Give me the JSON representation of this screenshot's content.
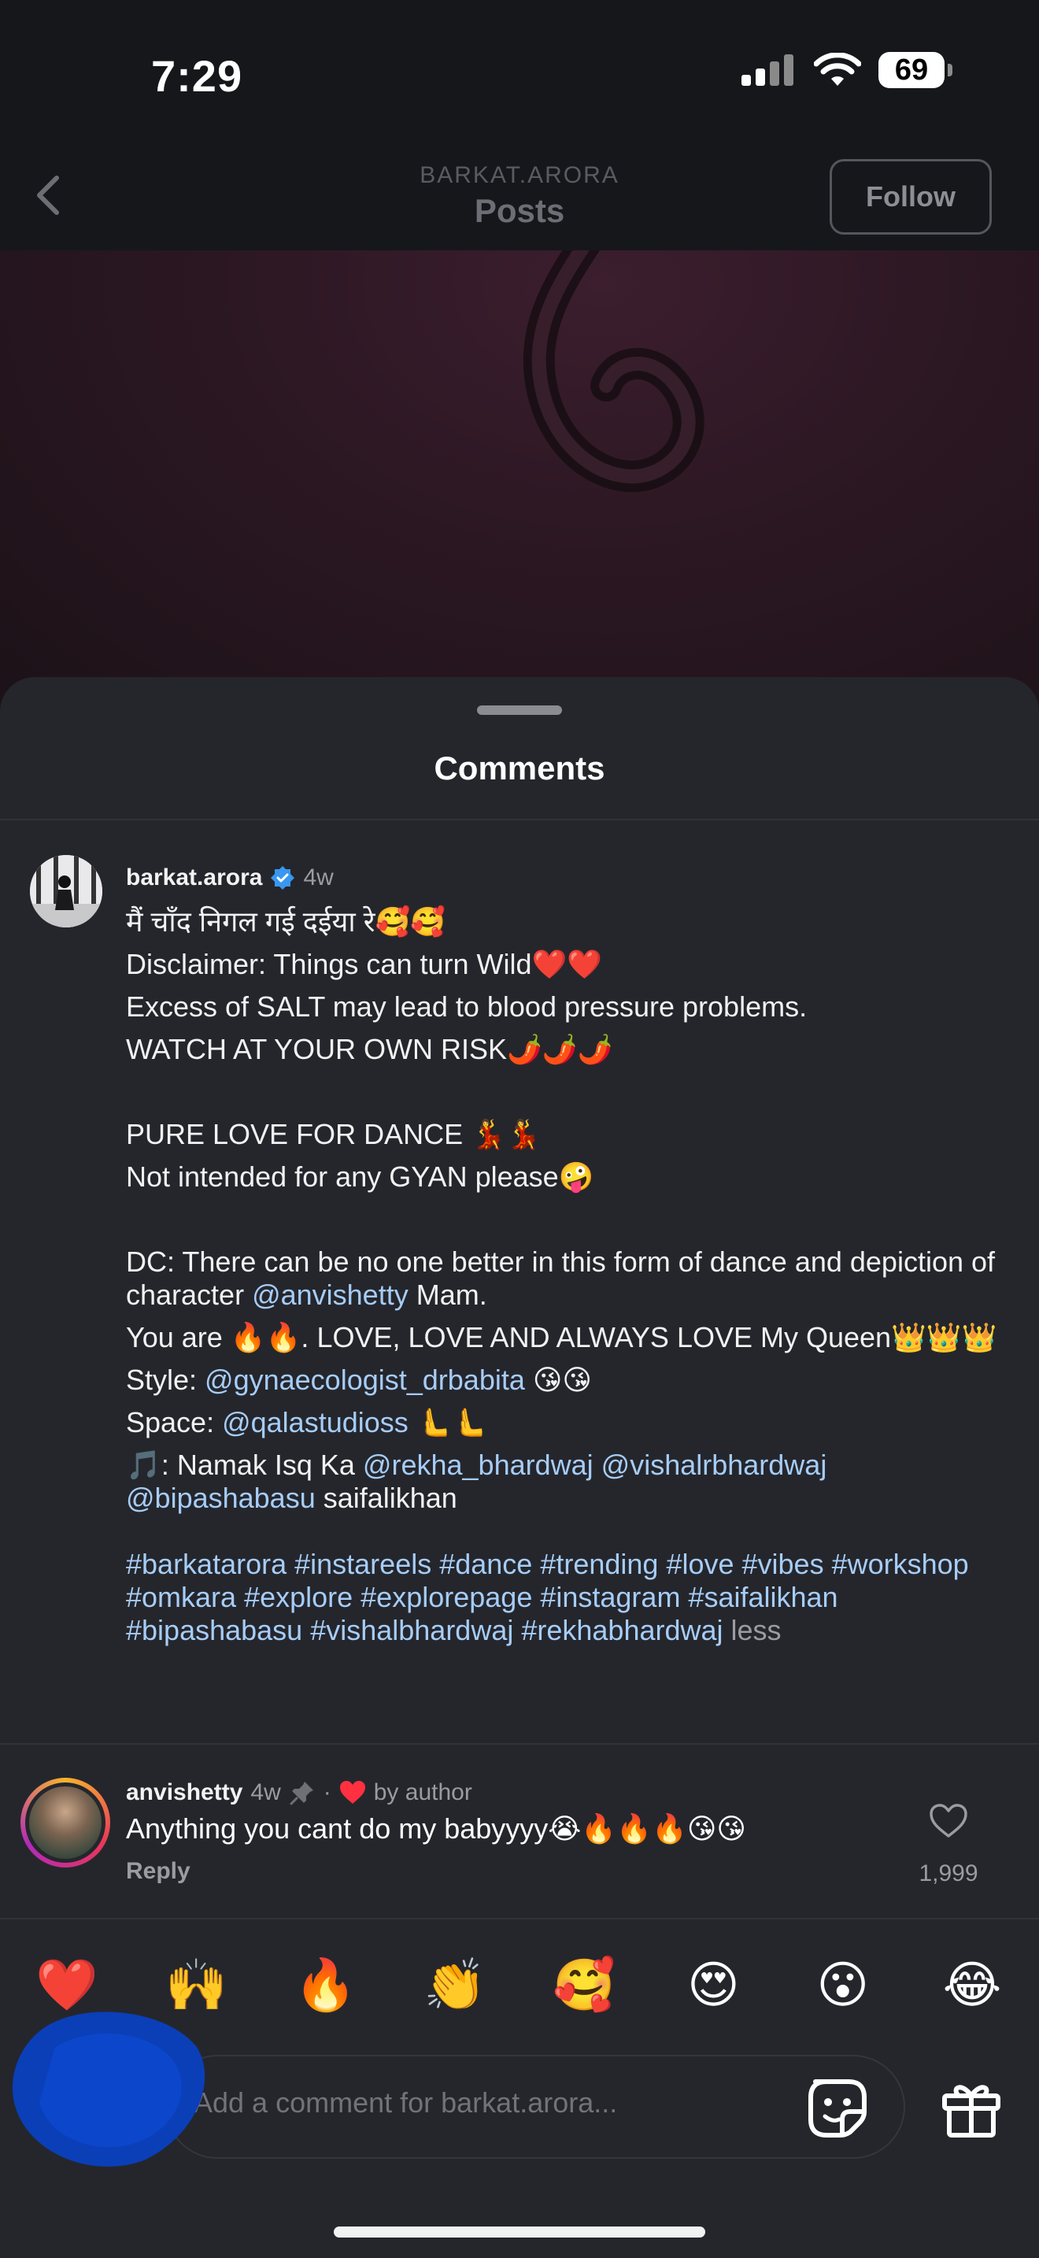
{
  "status_bar": {
    "time": "7:29",
    "battery": "69"
  },
  "header": {
    "subtitle": "BARKAT.ARORA",
    "title": "Posts",
    "follow_label": "Follow"
  },
  "sheet": {
    "title": "Comments"
  },
  "caption": {
    "username": "barkat.arora",
    "time": "4w",
    "lines": {
      "l1": "मैं चाँद निगल गई दईया रे🥰🥰",
      "l2": "Disclaimer: Things can turn Wild❤️❤️",
      "l3": "Excess of SALT may lead to blood pressure problems.",
      "l4": "WATCH AT YOUR OWN RISK🌶️🌶️🌶️",
      "l5": "PURE LOVE FOR DANCE 💃💃",
      "l6": "Not intended for any GYAN please🤪",
      "dc_a": "DC: There can be no one better in this form of dance and depiction of character ",
      "dc_mention": "@anvishetty",
      "dc_b": " Mam.",
      "l8": "You are 🔥🔥. LOVE, LOVE AND ALWAYS LOVE My Queen👑👑👑",
      "style_label": "Style: ",
      "style_mention": "@gynaecologist_drbabita",
      "style_emoji": " 😘😘",
      "space_label": "Space: ",
      "space_mention": "@qalastudioss",
      "space_emoji": " 🫷🫷",
      "music_label": "🎵: Namak Isq Ka ",
      "music_m1": "@rekha_bhardwaj",
      "music_m2": "@vishalrbhardwaj",
      "music_m3": "@bipashabasu",
      "music_end": " saifalikhan",
      "hashtags": "#barkatarora #instareels #dance #trending #love #vibes #workshop #omkara #explore #explorepage #instagram #saifalikhan #bipashabasu #vishalbhardwaj #rekhabhardwaj",
      "less": "less"
    }
  },
  "comment": {
    "username": "anvishetty",
    "time": "4w",
    "by_author": "by author",
    "text": "Anything you cant do my babyyyy😭🔥🔥🔥😘😘",
    "reply": "Reply",
    "likes": "1,999"
  },
  "reactions": [
    "❤️",
    "🙌",
    "🔥",
    "👏",
    "🥰",
    "😍",
    "😮",
    "😂"
  ],
  "input": {
    "placeholder": "Add a comment for barkat.arora..."
  },
  "icons": {
    "back": "chevron-left-icon",
    "verified": "verified-badge-icon",
    "pin": "pin-icon",
    "heart_filled": "red-heart-icon",
    "like": "heart-outline-icon",
    "sticker": "sticker-icon",
    "gift": "gift-icon"
  },
  "colors": {
    "link": "#a6cdf8",
    "verified": "#3897f0",
    "red_heart": "#ff3040",
    "sheet_bg": "#25262c"
  }
}
